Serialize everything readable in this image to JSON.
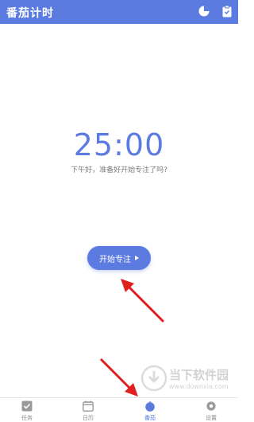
{
  "app": {
    "title": "番茄计时"
  },
  "toolbar": {
    "stats_icon": "pie-chart-icon",
    "clipboard_icon": "clipboard-icon"
  },
  "timer": {
    "time": "25:00",
    "greeting": "下午好，准备好开始专注了吗?",
    "start_label": "开始专注"
  },
  "tabs": [
    {
      "label": "任务",
      "icon": "checkbox-icon",
      "active": false
    },
    {
      "label": "日历",
      "icon": "calendar-icon",
      "active": false
    },
    {
      "label": "番茄",
      "icon": "tomato-icon",
      "active": true
    },
    {
      "label": "设置",
      "icon": "settings-icon",
      "active": false
    }
  ],
  "watermark": {
    "title": "当下软件园",
    "url": "www.downxia.com"
  },
  "colors": {
    "accent": "#5b7be0",
    "annotation_arrow": "#e02020"
  }
}
